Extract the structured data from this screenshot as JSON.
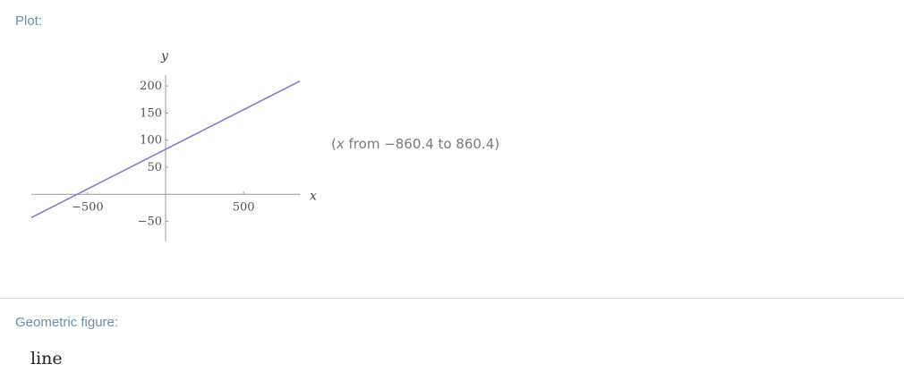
{
  "plot_pod": {
    "title": "Plot:",
    "range_note": {
      "open": "(",
      "var": "x",
      "text": " from −860.4 to 860.4)"
    }
  },
  "geometric_pod": {
    "title": "Geometric figure:",
    "value": "line"
  },
  "chart_data": {
    "type": "line",
    "xlabel": "x",
    "ylabel": "y",
    "xlim": [
      -860.4,
      860.4
    ],
    "ylim": [
      -87,
      220
    ],
    "x_ticks": [
      -500,
      500
    ],
    "x_tick_labels": [
      "−500",
      "500"
    ],
    "y_ticks": [
      -50,
      50,
      100,
      150,
      200
    ],
    "y_tick_labels": [
      "−50",
      "50",
      "100",
      "150",
      "200"
    ],
    "grid": false,
    "series": [
      {
        "color": "#7b7fc9",
        "x": [
          -860.4,
          860.4
        ],
        "y": [
          -43,
          209
        ]
      }
    ]
  }
}
